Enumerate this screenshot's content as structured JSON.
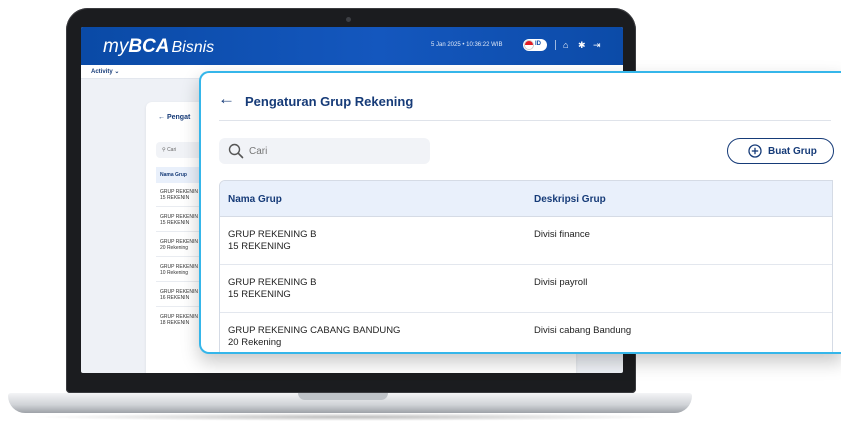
{
  "background_app": {
    "logo": {
      "prefix": "my",
      "brand": "BCA",
      "suffix": "Bisnis"
    },
    "header_datetime": "5 Jan 2025 • 10:36:22 WIB",
    "language": "ID",
    "activity_menu": "Activity ⌄",
    "page_title": "Pengat",
    "search_placeholder": "Cari",
    "table_header": "Nama Grup",
    "rows": [
      {
        "line1": "GRUP REKENIN",
        "line2": "15 REKENIN"
      },
      {
        "line1": "GRUP REKENIN",
        "line2": "15 REKENIN"
      },
      {
        "line1": "GRUP REKENIN",
        "line2": "20 Rekening"
      },
      {
        "line1": "GRUP REKENIN",
        "line2": "10 Rekening"
      },
      {
        "line1": "GRUP REKENIN",
        "line2": "16 REKENIN"
      },
      {
        "line1": "GRUP REKENIN",
        "line2": "18 REKENIN"
      }
    ]
  },
  "panel": {
    "back_icon": "←",
    "title": "Pengaturan Grup Rekening",
    "search": {
      "placeholder": "Cari",
      "value": ""
    },
    "create_button": "Buat Grup",
    "table": {
      "headers": [
        "Nama Grup",
        "Deskripsi Grup"
      ],
      "rows": [
        {
          "name": "GRUP REKENING B",
          "count": "15 REKENING",
          "description": "Divisi finance"
        },
        {
          "name": "GRUP REKENING B",
          "count": "15 REKENING",
          "description": "Divisi payroll"
        },
        {
          "name": "GRUP REKENING CABANG BANDUNG",
          "count": "20 Rekening",
          "description": "Divisi cabang Bandung"
        }
      ]
    }
  },
  "icons": [
    "search-icon",
    "plus-circle-icon",
    "back-arrow-icon",
    "home-icon",
    "gear-icon",
    "logout-icon"
  ],
  "colors": {
    "brand_blue": "#0a4aa6",
    "navy_text": "#163b78",
    "panel_border": "#35b6ea",
    "header_row_bg": "#e9f0fb"
  }
}
